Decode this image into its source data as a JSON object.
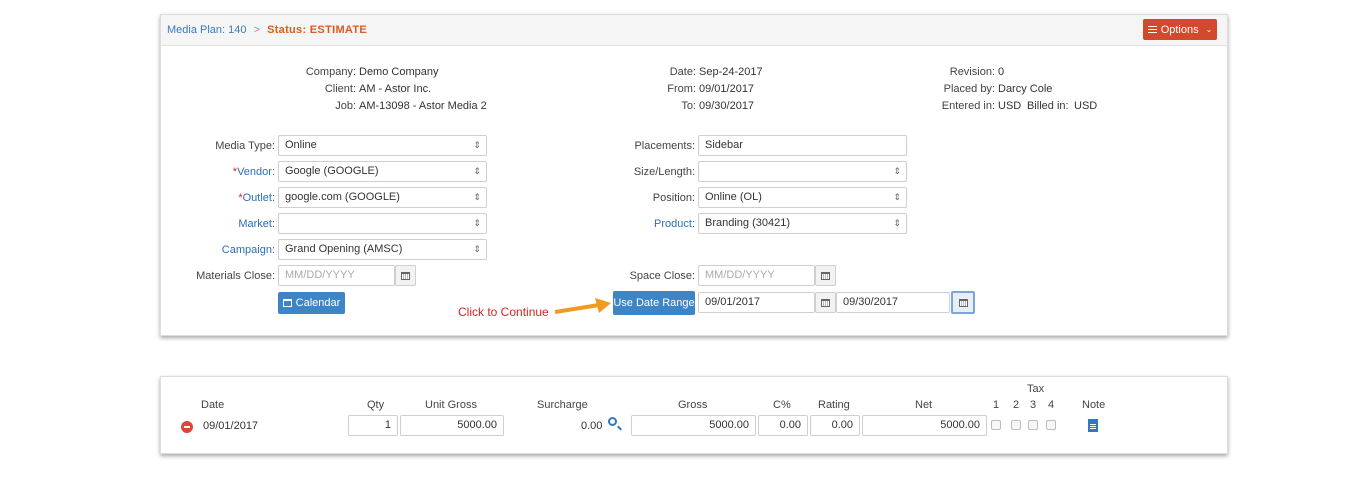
{
  "breadcrumb": {
    "plan": "Media Plan: 140",
    "sep": ">",
    "status": "Status: ESTIMATE"
  },
  "options_button": {
    "label": "Options",
    "icon": "list-icon",
    "caret": "chevron-down-icon"
  },
  "info": {
    "company": {
      "label": "Company:",
      "value": "Demo Company"
    },
    "client": {
      "label": "Client:",
      "value": "AM - Astor Inc."
    },
    "job": {
      "label": "Job:",
      "value": "AM-13098 - Astor Media 2"
    },
    "date": {
      "label": "Date:",
      "value": "Sep-24-2017"
    },
    "from": {
      "label": "From:",
      "value": "09/01/2017"
    },
    "to": {
      "label": "To:",
      "value": "09/30/2017"
    },
    "revision": {
      "label": "Revision:",
      "value": "0"
    },
    "placed_by": {
      "label": "Placed by:",
      "value": "Darcy Cole"
    },
    "entered_in": {
      "label": "Entered in:",
      "value": "USD"
    },
    "billed_in": {
      "label": "Billed in:",
      "value": "USD"
    }
  },
  "form": {
    "media_type": {
      "label": "Media Type:",
      "value": "Online"
    },
    "vendor": {
      "star": "*",
      "label": "Vendor:",
      "value": "Google (GOOGLE)"
    },
    "outlet": {
      "star": "*",
      "label": "Outlet:",
      "value": "google.com (GOOGLE)"
    },
    "market": {
      "label": "Market:",
      "value": ""
    },
    "campaign": {
      "label": "Campaign:",
      "value": "Grand Opening (AMSC)"
    },
    "materials_close": {
      "label": "Materials Close:",
      "placeholder": "MM/DD/YYYY"
    },
    "calendar_button": "Calendar",
    "placements": {
      "label": "Placements:",
      "value": "Sidebar"
    },
    "size_length": {
      "label": "Size/Length:",
      "value": ""
    },
    "position": {
      "label": "Position:",
      "value": "Online (OL)"
    },
    "product": {
      "label": "Product:",
      "value": "Branding (30421)"
    },
    "space_close": {
      "label": "Space Close:",
      "placeholder": "MM/DD/YYYY"
    },
    "use_date_range_button": "Use Date Range",
    "range_start": "09/01/2017",
    "range_end": "09/30/2017",
    "click_note": "Click to Continue"
  },
  "line_table": {
    "headers": {
      "date": "Date",
      "qty": "Qty",
      "unit_gross": "Unit Gross",
      "surcharge": "Surcharge",
      "gross": "Gross",
      "c_pct": "C%",
      "rating": "Rating",
      "net": "Net",
      "tax": "Tax",
      "tax1": "1",
      "tax2": "2",
      "tax3": "3",
      "tax4": "4",
      "note": "Note"
    },
    "row": {
      "date": "09/01/2017",
      "qty": "1",
      "unit_gross": "5000.00",
      "surcharge": "0.00",
      "gross": "5000.00",
      "c_pct": "0.00",
      "rating": "0.00",
      "net": "5000.00"
    }
  },
  "colors": {
    "status": "#e05a1f",
    "options_btn": "#d2492c",
    "primary_btn": "#3d85c6",
    "link": "#2e6eb5",
    "required": "#d9261c",
    "annotation": "#e02020",
    "arrow": "#f29a1f"
  }
}
